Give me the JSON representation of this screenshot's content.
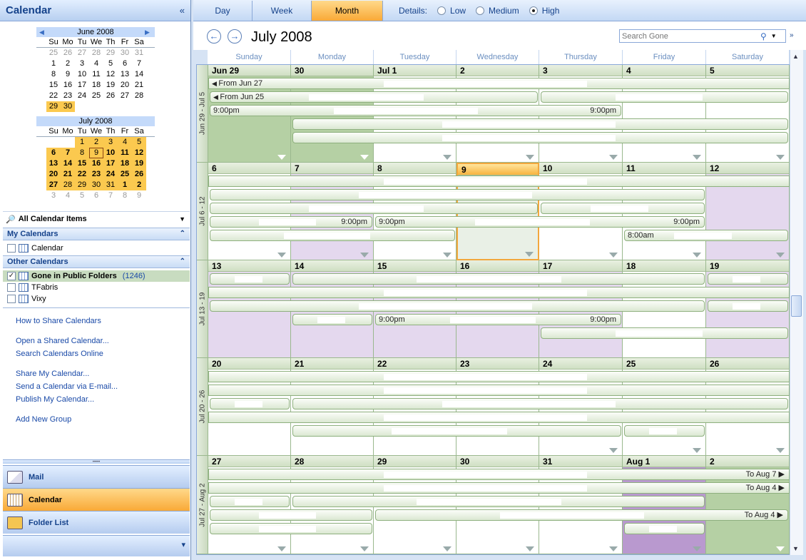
{
  "sidebar": {
    "title": "Calendar",
    "collapse_glyph": "«",
    "minical_june": {
      "title": "June 2008",
      "days": [
        "Su",
        "Mo",
        "Tu",
        "We",
        "Th",
        "Fr",
        "Sa"
      ],
      "weeks": [
        [
          "25",
          "26",
          "27",
          "28",
          "29",
          "30",
          "31"
        ],
        [
          "1",
          "2",
          "3",
          "4",
          "5",
          "6",
          "7"
        ],
        [
          "8",
          "9",
          "10",
          "11",
          "12",
          "13",
          "14"
        ],
        [
          "15",
          "16",
          "17",
          "18",
          "19",
          "20",
          "21"
        ],
        [
          "22",
          "23",
          "24",
          "25",
          "26",
          "27",
          "28"
        ],
        [
          "29",
          "30",
          "",
          "",
          "",
          "",
          ""
        ]
      ]
    },
    "minical_july": {
      "title": "July 2008",
      "days": [
        "Su",
        "Mo",
        "Tu",
        "We",
        "Th",
        "Fr",
        "Sa"
      ],
      "weeks": [
        [
          "",
          "",
          "1",
          "2",
          "3",
          "4",
          "5"
        ],
        [
          "6",
          "7",
          "8",
          "9",
          "10",
          "11",
          "12"
        ],
        [
          "13",
          "14",
          "15",
          "16",
          "17",
          "18",
          "19"
        ],
        [
          "20",
          "21",
          "22",
          "23",
          "24",
          "25",
          "26"
        ],
        [
          "27",
          "28",
          "29",
          "30",
          "31",
          "1",
          "2"
        ],
        [
          "3",
          "4",
          "5",
          "6",
          "7",
          "8",
          "9"
        ]
      ]
    },
    "all_items": "All Calendar Items",
    "my_calendars": {
      "header": "My Calendars",
      "items": [
        {
          "label": "Calendar",
          "checked": false
        }
      ]
    },
    "other_calendars": {
      "header": "Other Calendars",
      "items": [
        {
          "label": "Gone in Public Folders",
          "count": "(1246)",
          "checked": true
        },
        {
          "label": "TFabris",
          "checked": false
        },
        {
          "label": "Vixy",
          "checked": false
        }
      ]
    },
    "links": [
      "How to Share Calendars",
      "Open a Shared Calendar...",
      "Search Calendars Online",
      "Share My Calendar...",
      "Send a Calendar via E-mail...",
      "Publish My Calendar...",
      "Add New Group"
    ],
    "nav": {
      "mail": "Mail",
      "calendar": "Calendar",
      "folder_list": "Folder List"
    }
  },
  "toolbar": {
    "views": {
      "day": "Day",
      "week": "Week",
      "month": "Month"
    },
    "active_view": "Month",
    "details_label": "Details:",
    "details": {
      "low": "Low",
      "medium": "Medium",
      "high": "High"
    },
    "details_selected": "High"
  },
  "header": {
    "month_title": "July 2008",
    "search_placeholder": "Search Gone"
  },
  "day_names": [
    "Sunday",
    "Monday",
    "Tuesday",
    "Wednesday",
    "Thursday",
    "Friday",
    "Saturday"
  ],
  "weeks": [
    {
      "label": "Jun 29 - Jul 5",
      "dates": [
        "Jun 29",
        "30",
        "Jul 1",
        "2",
        "3",
        "4",
        "5"
      ]
    },
    {
      "label": "Jul 6 - 12",
      "dates": [
        "6",
        "7",
        "8",
        "9",
        "10",
        "11",
        "12"
      ]
    },
    {
      "label": "Jul 13 - 19",
      "dates": [
        "13",
        "14",
        "15",
        "16",
        "17",
        "18",
        "19"
      ]
    },
    {
      "label": "Jul 20 - 26",
      "dates": [
        "20",
        "21",
        "22",
        "23",
        "24",
        "25",
        "26"
      ]
    },
    {
      "label": "Jul 27 - Aug 2",
      "dates": [
        "27",
        "28",
        "29",
        "30",
        "31",
        "Aug 1",
        "2"
      ]
    }
  ],
  "event_texts": {
    "from_jun27": "From Jun 27",
    "from_jun25": "From Jun 25",
    "time_900pm": "9:00pm",
    "time_800am": "8:00am",
    "to_aug7": "To Aug 7",
    "to_aug4": "To Aug 4"
  },
  "colors": {
    "accent": "#f9a937",
    "header_blue": "#15428b",
    "event_green": "#8eb07e"
  }
}
